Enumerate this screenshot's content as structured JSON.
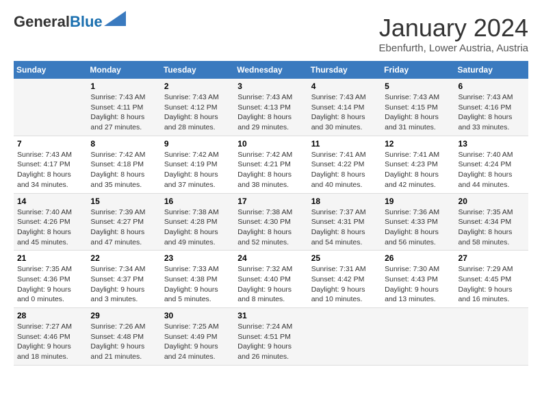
{
  "logo": {
    "line1": "General",
    "line2": "Blue"
  },
  "header": {
    "month": "January 2024",
    "location": "Ebenfurth, Lower Austria, Austria"
  },
  "weekdays": [
    "Sunday",
    "Monday",
    "Tuesday",
    "Wednesday",
    "Thursday",
    "Friday",
    "Saturday"
  ],
  "weeks": [
    [
      {
        "day": "",
        "sunrise": "",
        "sunset": "",
        "daylight": ""
      },
      {
        "day": "1",
        "sunrise": "Sunrise: 7:43 AM",
        "sunset": "Sunset: 4:11 PM",
        "daylight": "Daylight: 8 hours and 27 minutes."
      },
      {
        "day": "2",
        "sunrise": "Sunrise: 7:43 AM",
        "sunset": "Sunset: 4:12 PM",
        "daylight": "Daylight: 8 hours and 28 minutes."
      },
      {
        "day": "3",
        "sunrise": "Sunrise: 7:43 AM",
        "sunset": "Sunset: 4:13 PM",
        "daylight": "Daylight: 8 hours and 29 minutes."
      },
      {
        "day": "4",
        "sunrise": "Sunrise: 7:43 AM",
        "sunset": "Sunset: 4:14 PM",
        "daylight": "Daylight: 8 hours and 30 minutes."
      },
      {
        "day": "5",
        "sunrise": "Sunrise: 7:43 AM",
        "sunset": "Sunset: 4:15 PM",
        "daylight": "Daylight: 8 hours and 31 minutes."
      },
      {
        "day": "6",
        "sunrise": "Sunrise: 7:43 AM",
        "sunset": "Sunset: 4:16 PM",
        "daylight": "Daylight: 8 hours and 33 minutes."
      }
    ],
    [
      {
        "day": "7",
        "sunrise": "Sunrise: 7:43 AM",
        "sunset": "Sunset: 4:17 PM",
        "daylight": "Daylight: 8 hours and 34 minutes."
      },
      {
        "day": "8",
        "sunrise": "Sunrise: 7:42 AM",
        "sunset": "Sunset: 4:18 PM",
        "daylight": "Daylight: 8 hours and 35 minutes."
      },
      {
        "day": "9",
        "sunrise": "Sunrise: 7:42 AM",
        "sunset": "Sunset: 4:19 PM",
        "daylight": "Daylight: 8 hours and 37 minutes."
      },
      {
        "day": "10",
        "sunrise": "Sunrise: 7:42 AM",
        "sunset": "Sunset: 4:21 PM",
        "daylight": "Daylight: 8 hours and 38 minutes."
      },
      {
        "day": "11",
        "sunrise": "Sunrise: 7:41 AM",
        "sunset": "Sunset: 4:22 PM",
        "daylight": "Daylight: 8 hours and 40 minutes."
      },
      {
        "day": "12",
        "sunrise": "Sunrise: 7:41 AM",
        "sunset": "Sunset: 4:23 PM",
        "daylight": "Daylight: 8 hours and 42 minutes."
      },
      {
        "day": "13",
        "sunrise": "Sunrise: 7:40 AM",
        "sunset": "Sunset: 4:24 PM",
        "daylight": "Daylight: 8 hours and 44 minutes."
      }
    ],
    [
      {
        "day": "14",
        "sunrise": "Sunrise: 7:40 AM",
        "sunset": "Sunset: 4:26 PM",
        "daylight": "Daylight: 8 hours and 45 minutes."
      },
      {
        "day": "15",
        "sunrise": "Sunrise: 7:39 AM",
        "sunset": "Sunset: 4:27 PM",
        "daylight": "Daylight: 8 hours and 47 minutes."
      },
      {
        "day": "16",
        "sunrise": "Sunrise: 7:38 AM",
        "sunset": "Sunset: 4:28 PM",
        "daylight": "Daylight: 8 hours and 49 minutes."
      },
      {
        "day": "17",
        "sunrise": "Sunrise: 7:38 AM",
        "sunset": "Sunset: 4:30 PM",
        "daylight": "Daylight: 8 hours and 52 minutes."
      },
      {
        "day": "18",
        "sunrise": "Sunrise: 7:37 AM",
        "sunset": "Sunset: 4:31 PM",
        "daylight": "Daylight: 8 hours and 54 minutes."
      },
      {
        "day": "19",
        "sunrise": "Sunrise: 7:36 AM",
        "sunset": "Sunset: 4:33 PM",
        "daylight": "Daylight: 8 hours and 56 minutes."
      },
      {
        "day": "20",
        "sunrise": "Sunrise: 7:35 AM",
        "sunset": "Sunset: 4:34 PM",
        "daylight": "Daylight: 8 hours and 58 minutes."
      }
    ],
    [
      {
        "day": "21",
        "sunrise": "Sunrise: 7:35 AM",
        "sunset": "Sunset: 4:36 PM",
        "daylight": "Daylight: 9 hours and 0 minutes."
      },
      {
        "day": "22",
        "sunrise": "Sunrise: 7:34 AM",
        "sunset": "Sunset: 4:37 PM",
        "daylight": "Daylight: 9 hours and 3 minutes."
      },
      {
        "day": "23",
        "sunrise": "Sunrise: 7:33 AM",
        "sunset": "Sunset: 4:38 PM",
        "daylight": "Daylight: 9 hours and 5 minutes."
      },
      {
        "day": "24",
        "sunrise": "Sunrise: 7:32 AM",
        "sunset": "Sunset: 4:40 PM",
        "daylight": "Daylight: 9 hours and 8 minutes."
      },
      {
        "day": "25",
        "sunrise": "Sunrise: 7:31 AM",
        "sunset": "Sunset: 4:42 PM",
        "daylight": "Daylight: 9 hours and 10 minutes."
      },
      {
        "day": "26",
        "sunrise": "Sunrise: 7:30 AM",
        "sunset": "Sunset: 4:43 PM",
        "daylight": "Daylight: 9 hours and 13 minutes."
      },
      {
        "day": "27",
        "sunrise": "Sunrise: 7:29 AM",
        "sunset": "Sunset: 4:45 PM",
        "daylight": "Daylight: 9 hours and 16 minutes."
      }
    ],
    [
      {
        "day": "28",
        "sunrise": "Sunrise: 7:27 AM",
        "sunset": "Sunset: 4:46 PM",
        "daylight": "Daylight: 9 hours and 18 minutes."
      },
      {
        "day": "29",
        "sunrise": "Sunrise: 7:26 AM",
        "sunset": "Sunset: 4:48 PM",
        "daylight": "Daylight: 9 hours and 21 minutes."
      },
      {
        "day": "30",
        "sunrise": "Sunrise: 7:25 AM",
        "sunset": "Sunset: 4:49 PM",
        "daylight": "Daylight: 9 hours and 24 minutes."
      },
      {
        "day": "31",
        "sunrise": "Sunrise: 7:24 AM",
        "sunset": "Sunset: 4:51 PM",
        "daylight": "Daylight: 9 hours and 26 minutes."
      },
      {
        "day": "",
        "sunrise": "",
        "sunset": "",
        "daylight": ""
      },
      {
        "day": "",
        "sunrise": "",
        "sunset": "",
        "daylight": ""
      },
      {
        "day": "",
        "sunrise": "",
        "sunset": "",
        "daylight": ""
      }
    ]
  ]
}
